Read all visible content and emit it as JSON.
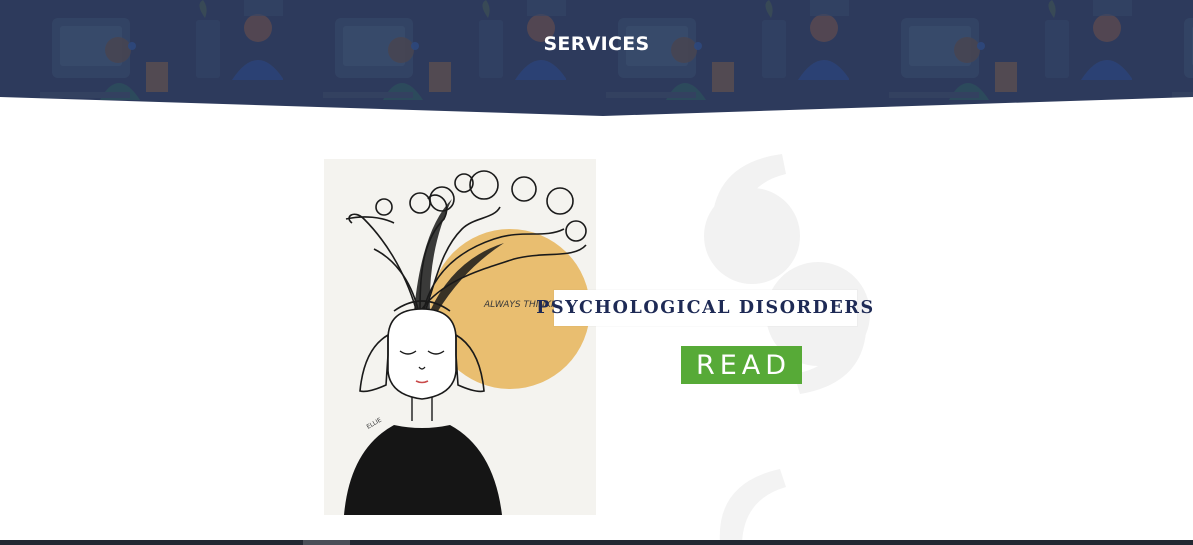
{
  "header": {
    "title": "SERVICES",
    "background_color": "#2f3d5f"
  },
  "service": {
    "image_caption_text": "ALWAYS THINKING",
    "image_signature": "ELLIE",
    "title": "PSYCHOLOGICAL DISORDERS",
    "title_color": "#1e2a55",
    "read_label": "READ",
    "read_color": "#57aa37"
  },
  "icons": {
    "decorative_quote": "quote-mark-icon"
  }
}
